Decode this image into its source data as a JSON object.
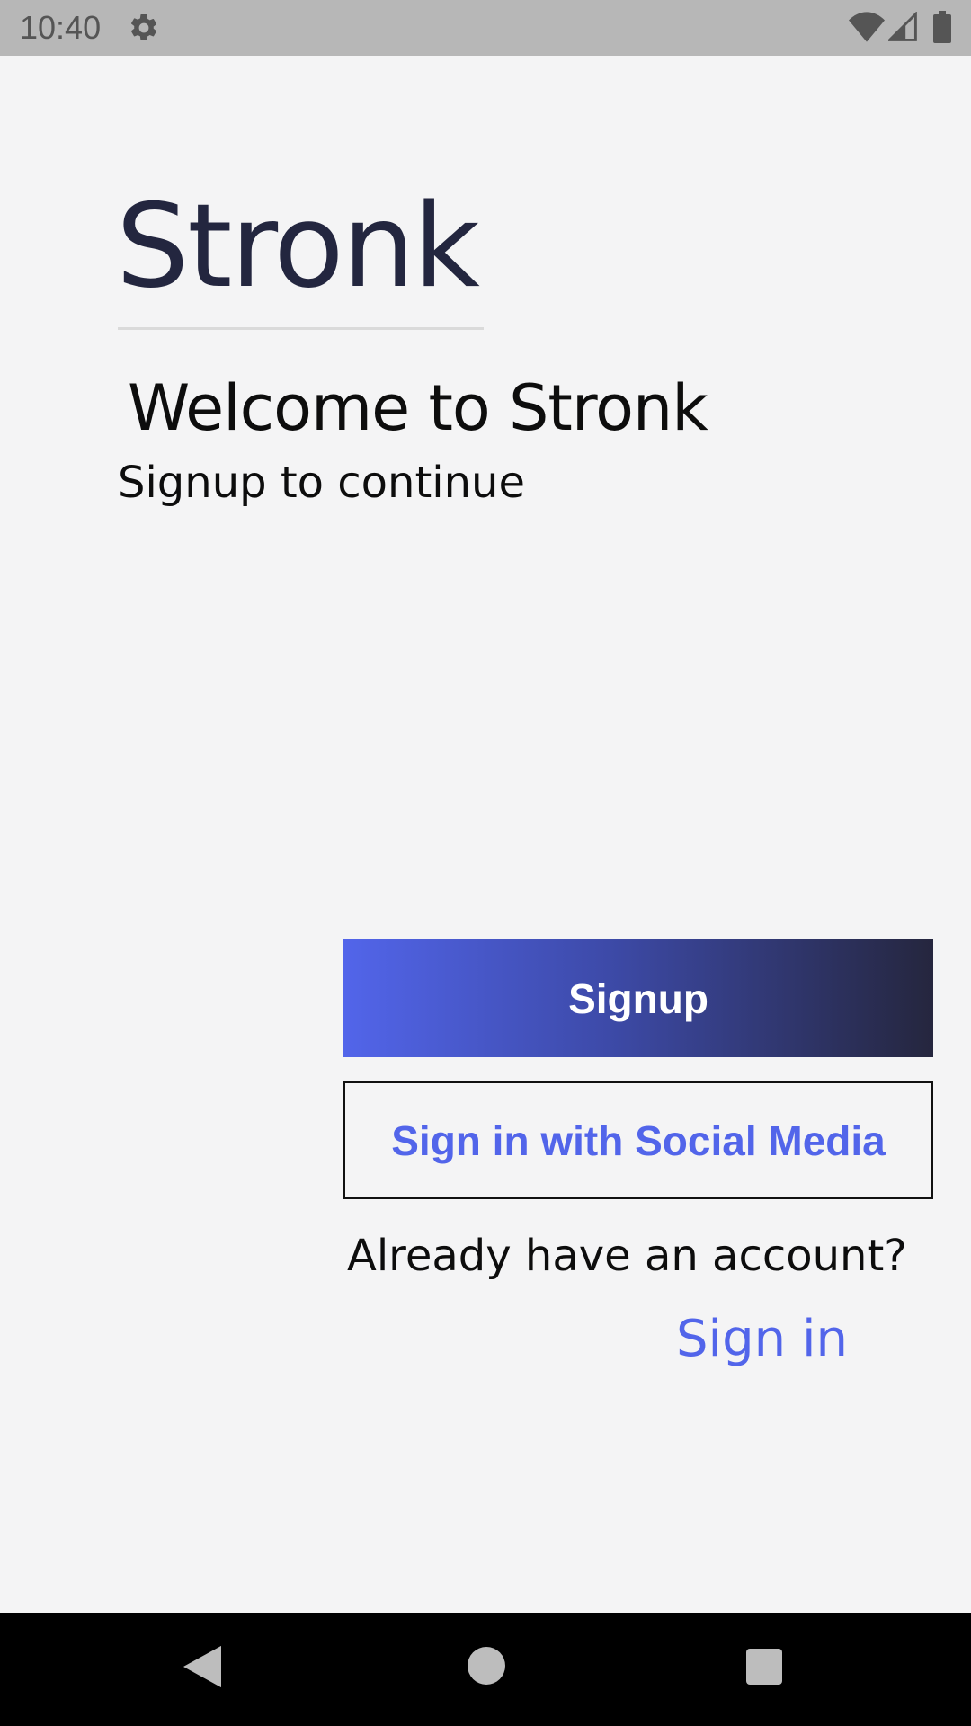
{
  "status_bar": {
    "time": "10:40",
    "icons": [
      "gear-icon",
      "wifi-icon",
      "signal-icon",
      "battery-icon"
    ]
  },
  "app": {
    "logo_text": "Stronk",
    "welcome_title": "Welcome to Stronk",
    "welcome_subtitle": "Signup to continue"
  },
  "actions": {
    "signup_label": "Signup",
    "social_label": "Sign in with Social Media",
    "already_account": "Already have an account?",
    "signin_label": "Sign in"
  },
  "nav_bar": {
    "icons": [
      "back-icon",
      "home-icon",
      "recent-apps-icon"
    ]
  },
  "colors": {
    "accent": "#5265ea",
    "dark": "#25263e",
    "background": "#f4f4f5"
  }
}
